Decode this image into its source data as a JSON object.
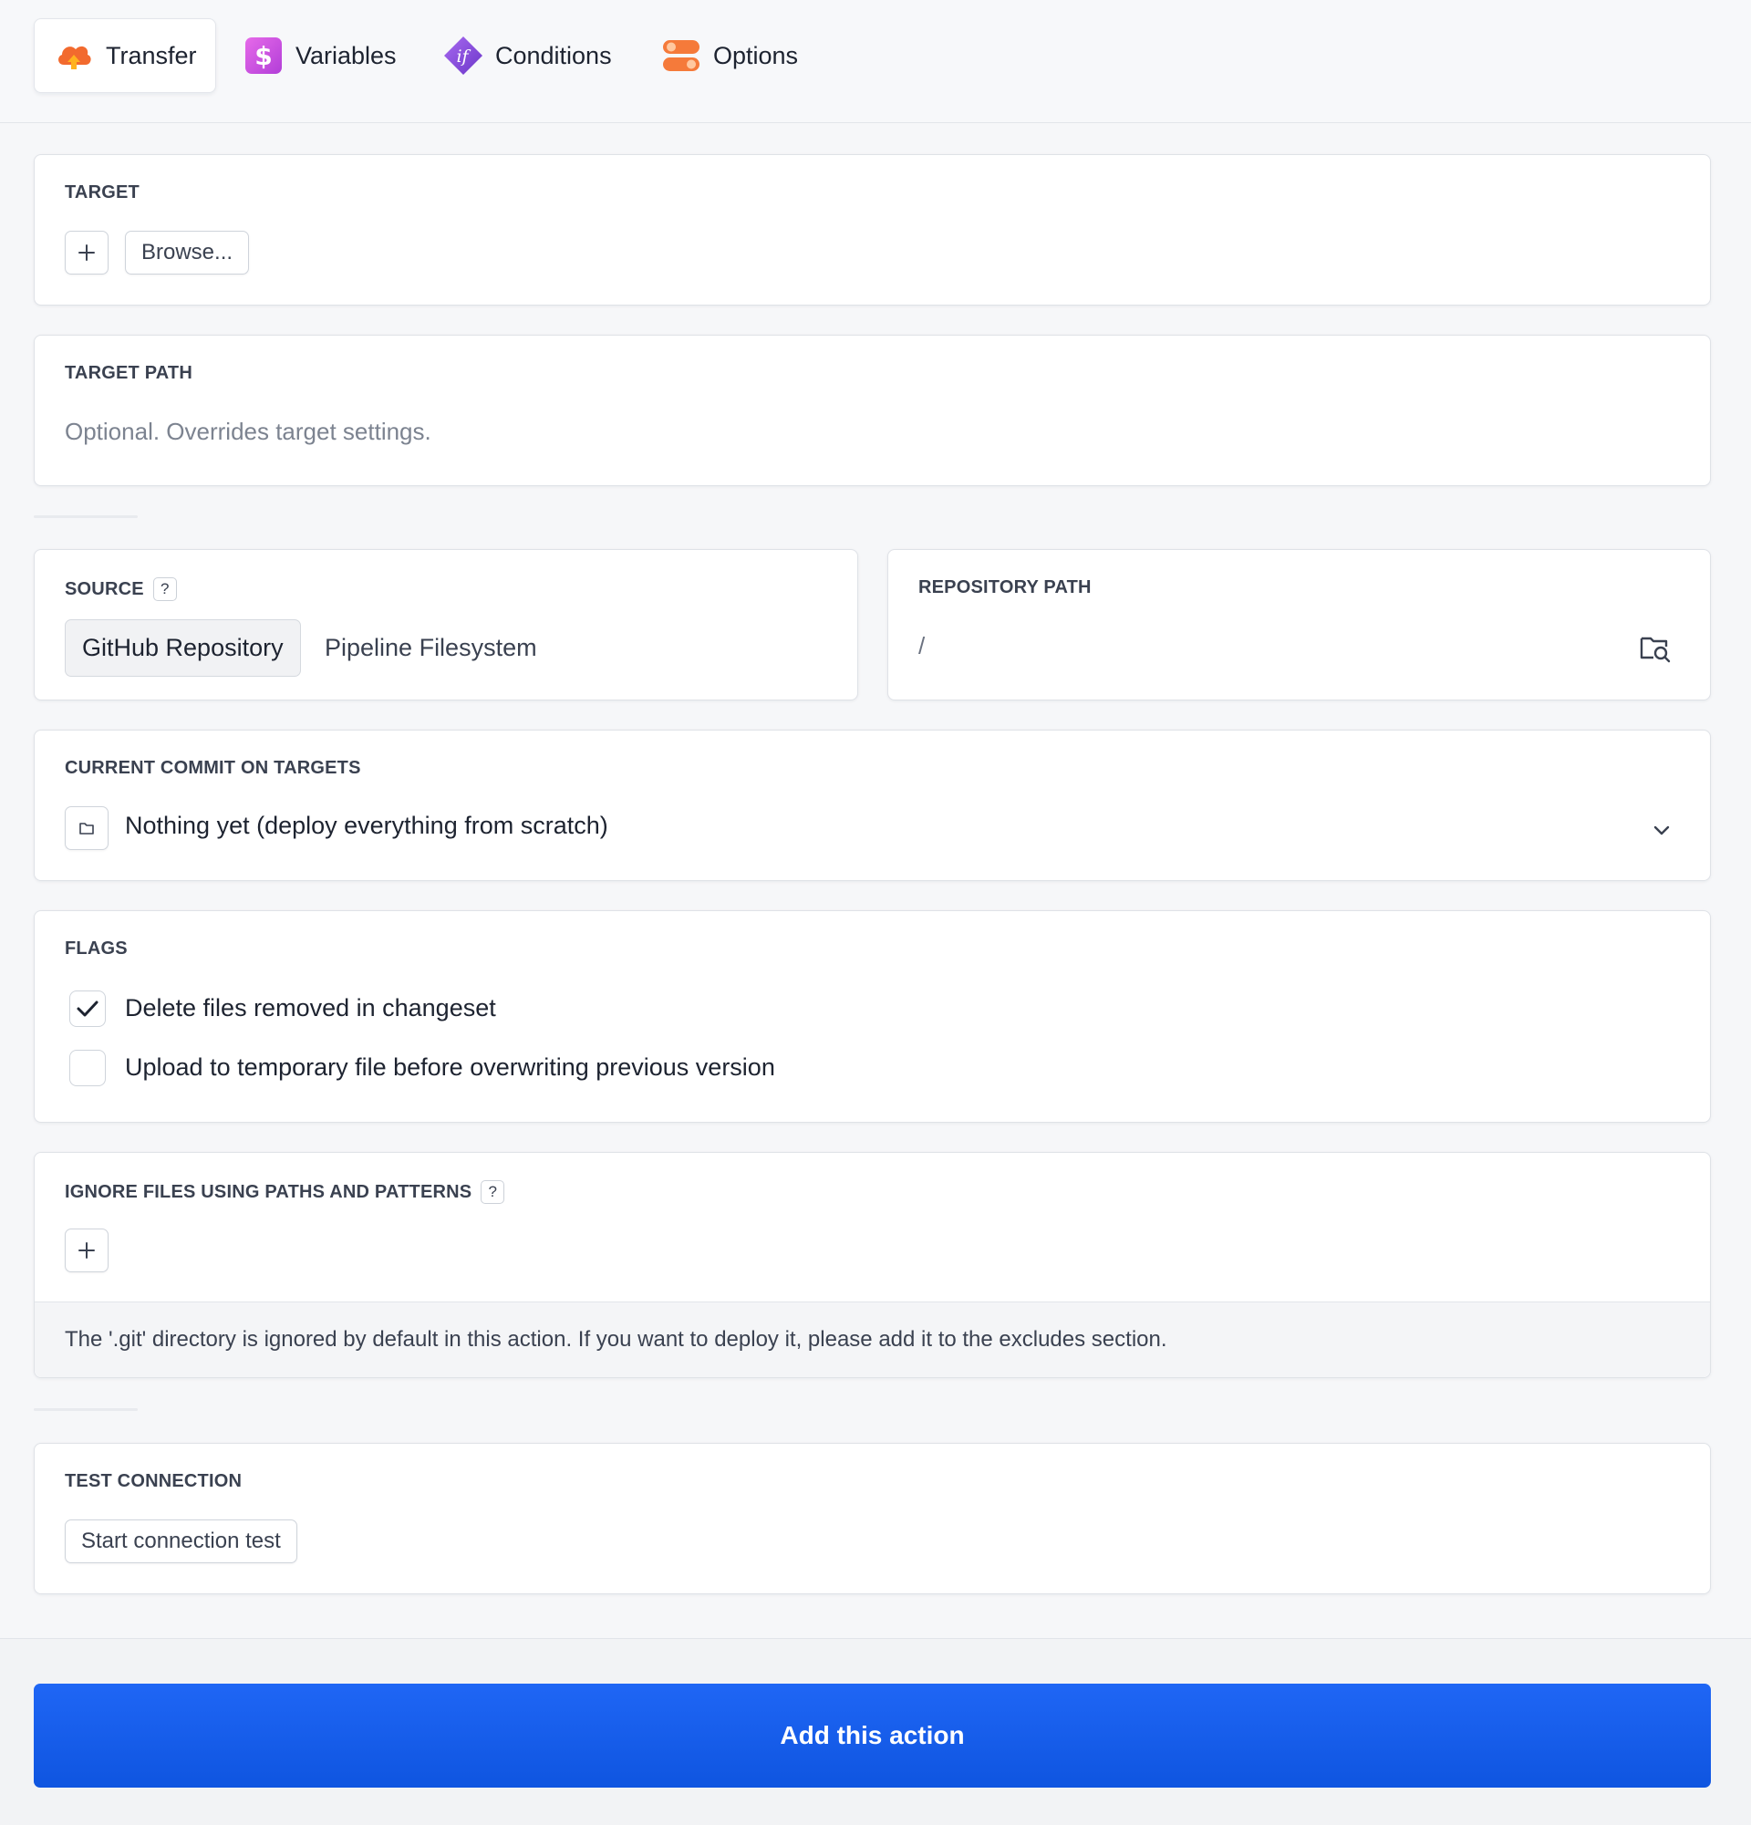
{
  "tabs": [
    {
      "label": "Transfer",
      "icon": "cloud-upload-icon",
      "active": true
    },
    {
      "label": "Variables",
      "icon": "dollar-icon",
      "active": false
    },
    {
      "label": "Conditions",
      "icon": "if-diamond-icon",
      "active": false
    },
    {
      "label": "Options",
      "icon": "toggles-icon",
      "active": false
    }
  ],
  "target": {
    "label": "TARGET",
    "browse_label": "Browse..."
  },
  "target_path": {
    "label": "TARGET PATH",
    "placeholder": "Optional. Overrides target settings."
  },
  "source": {
    "label": "SOURCE",
    "help": "?",
    "options": [
      "GitHub Repository",
      "Pipeline Filesystem"
    ],
    "selected": "GitHub Repository"
  },
  "repository_path": {
    "label": "REPOSITORY PATH",
    "value": "/"
  },
  "current_commit": {
    "label": "CURRENT COMMIT ON TARGETS",
    "value": "Nothing yet (deploy everything from scratch)"
  },
  "flags": {
    "label": "FLAGS",
    "items": [
      {
        "label": "Delete files removed in changeset",
        "checked": true
      },
      {
        "label": "Upload to temporary file before overwriting previous version",
        "checked": false
      }
    ]
  },
  "ignore_files": {
    "label": "IGNORE FILES USING PATHS AND PATTERNS",
    "help": "?",
    "note": "The '.git' directory is ignored by default in this action. If you want to deploy it, please add it to the excludes section."
  },
  "test_connection": {
    "label": "TEST CONNECTION",
    "button_label": "Start connection test"
  },
  "footer": {
    "submit_label": "Add this action"
  },
  "colors": {
    "primary": "#1a5ff0",
    "transfer_icon": "#f26a2e",
    "variables_icon": "#d552e6",
    "conditions_icon": "#8a4fe0",
    "options_icon": "#f57a3a"
  }
}
